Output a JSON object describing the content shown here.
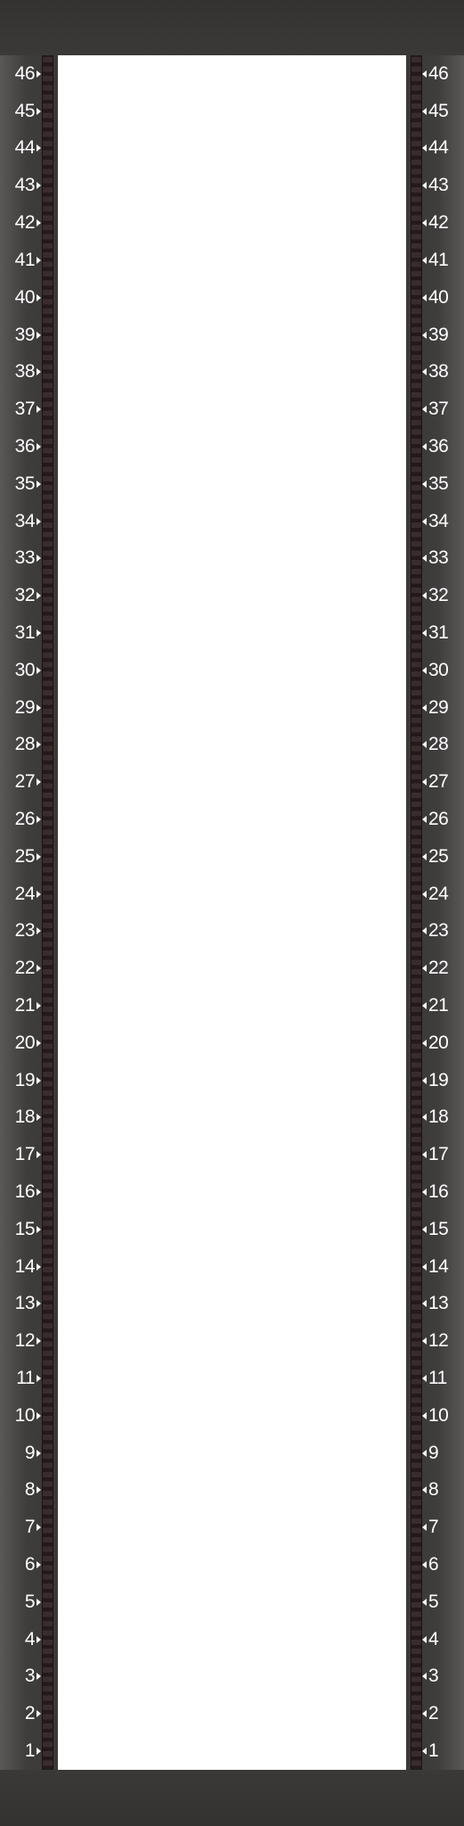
{
  "rack": {
    "units_top_to_bottom": [
      "46",
      "45",
      "44",
      "43",
      "42",
      "41",
      "40",
      "39",
      "38",
      "37",
      "36",
      "35",
      "34",
      "33",
      "32",
      "31",
      "30",
      "29",
      "28",
      "27",
      "26",
      "25",
      "24",
      "23",
      "22",
      "21",
      "20",
      "19",
      "18",
      "17",
      "16",
      "15",
      "14",
      "13",
      "12",
      "11",
      "10",
      "9",
      "8",
      "7",
      "6",
      "5",
      "4",
      "3",
      "2",
      "1"
    ],
    "colors": {
      "frame": "#3b3938",
      "rail": "#231a1b",
      "bay": "#ffffff",
      "label_text": "#ffffff"
    }
  }
}
